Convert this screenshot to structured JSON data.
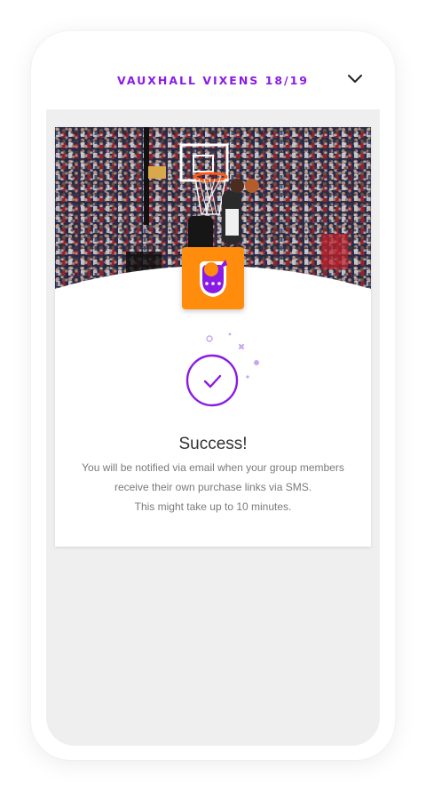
{
  "header": {
    "title": "VAUXHALL VIXENS 18/19",
    "dropdown_icon": "chevron-down-icon"
  },
  "banner": {
    "image": "basketball-arena-dunk-photo"
  },
  "team_logo": {
    "icon": "team-mascot-logo",
    "badge_color": "#ff8c0c"
  },
  "success": {
    "icon": "check-circle-icon",
    "title": "Success!",
    "message_line1": "You will be notified via email when your group members",
    "message_line2": "receive their own purchase links via SMS.",
    "message_line3": "This might take up to 10 minutes."
  },
  "colors": {
    "accent": "#8a1be5",
    "orange": "#ff8c0c",
    "background": "#efefef"
  }
}
